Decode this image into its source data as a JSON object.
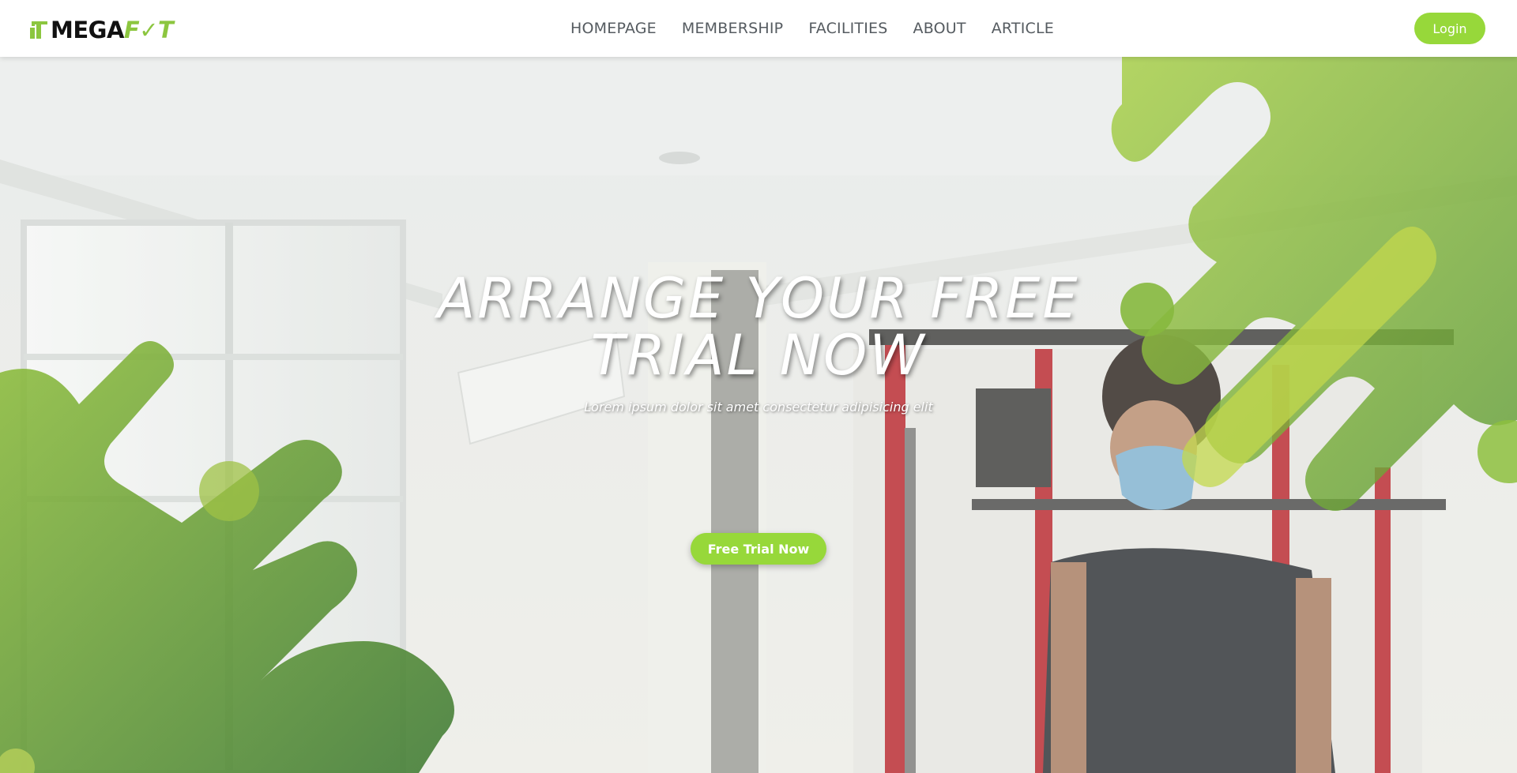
{
  "brand": {
    "name_prefix": "MEGA",
    "name_suffix": "F✓T",
    "accent_color": "#8cc63f"
  },
  "nav": {
    "links": [
      "HOMEPAGE",
      "MEMBERSHIP",
      "FACILITIES",
      "ABOUT",
      "ARTICLE"
    ],
    "login_label": "Login"
  },
  "hero": {
    "title_line1": "ARRANGE YOUR FREE",
    "title_line2": "TRIAL NOW",
    "subtitle": "Lorem ipsum dolor sit amet consectetur adipisicing elit",
    "cta_label": "Free Trial Now",
    "button_color": "#97d83a"
  }
}
